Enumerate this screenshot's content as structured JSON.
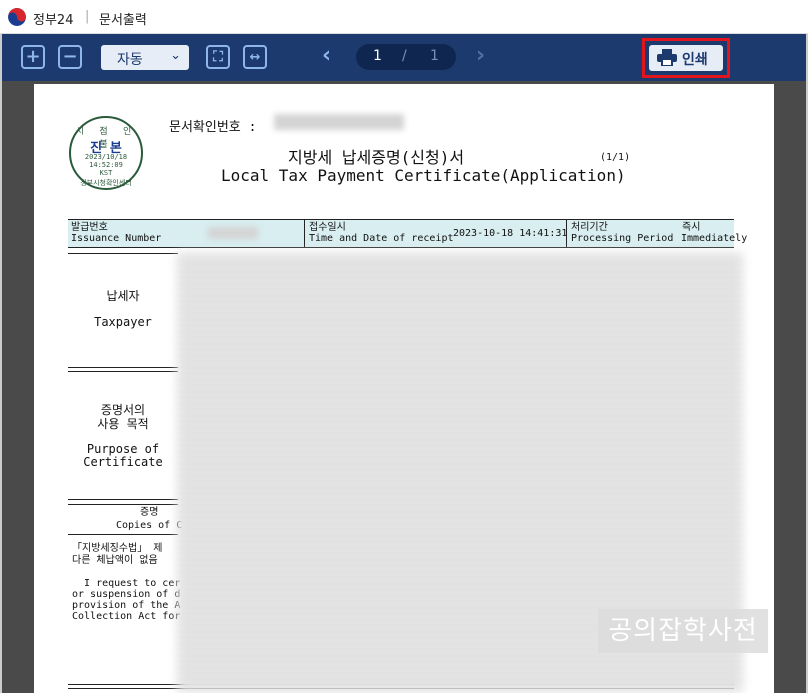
{
  "window": {
    "app_name": "정부24",
    "separator": "|",
    "doc_name": "문서출력"
  },
  "toolbar": {
    "zoom_in_icon": "+",
    "zoom_out_icon": "−",
    "zoom_value": "자동",
    "zoom_chevron": "⌄",
    "fit_page_icon": "⛶",
    "fit_width_icon": "↔",
    "prev_icon": "‹",
    "next_icon": "›",
    "page_current": "1",
    "page_sep": "/",
    "page_total": "1",
    "print_icon": "🖶",
    "print_label": "인쇄",
    "highlight_color": "#e2141c"
  },
  "document": {
    "stamp": {
      "top_text": "시 점 인 불",
      "main_text": "진 본",
      "date": "2023/10/18",
      "time": "14:52:09",
      "tz": "KST",
      "bottom_text": "정부시청확인센터"
    },
    "confirm_number_label": "문서확인번호 :",
    "title_ko": "지방세 납세증명(신청)서",
    "title_en": "Local Tax Payment Certificate(Application)",
    "page_count": "(1/1)",
    "issuance_label_ko": "발급번호",
    "issuance_label_en": "Issuance Number",
    "receipt_label_ko": "접수일시",
    "receipt_label_en": "Time and Date of receipt",
    "receipt_value": "2023-10-18 14:41:31",
    "processing_label_ko": "처리기간",
    "processing_label_en": "Processing Period",
    "processing_value_ko": "즉시",
    "processing_value_en": "Immediately",
    "taxpayer_ko": "납세자",
    "taxpayer_en": "Taxpayer",
    "purpose_ko_1": "증명서의",
    "purpose_ko_2": "사용 목적",
    "purpose_en_1": "Purpose of",
    "purpose_en_2": "Certificate",
    "copies_ko": "증명",
    "copies_en": "Copies of C",
    "law_ko_1": "「지방세징수법」 제",
    "law_ko_2": "다른 체납액이 없음",
    "law_en_1": "  I request to cer",
    "law_en_2": "or suspension of d",
    "law_en_3": "provision of the A",
    "law_en_4": "Collection Act for"
  },
  "watermark": "공의잡학사전"
}
